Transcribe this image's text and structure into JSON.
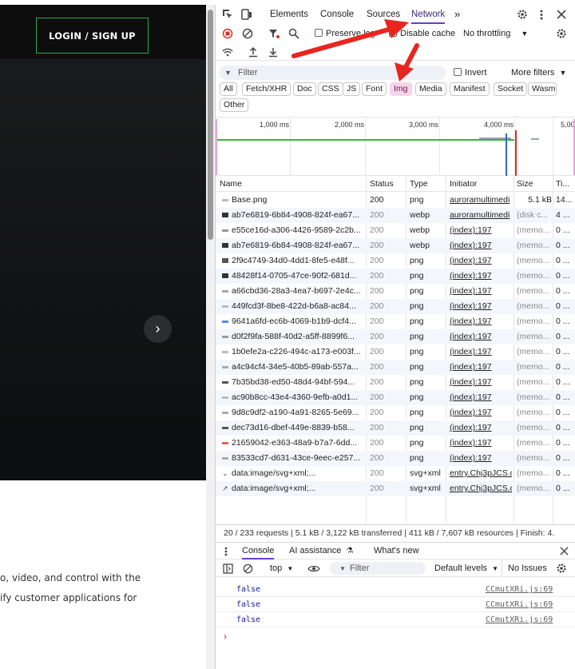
{
  "site": {
    "login_label": "LOGIN / SIGN UP",
    "next_arrow": "›",
    "paragraph_line1": "o, video, and control with the",
    "paragraph_line2": "ify customer applications for"
  },
  "devtools": {
    "tabs": [
      "Elements",
      "Console",
      "Sources",
      "Network"
    ],
    "more_tabs": "»",
    "preserve_log": "Preserve log",
    "disable_cache": "Disable cache",
    "throttling": "No throttling",
    "filter_placeholder": "Filter",
    "invert": "Invert",
    "more_filters": "More filters",
    "type_filters": [
      "All",
      "Fetch/XHR",
      "Doc",
      "CSS",
      "JS",
      "Font",
      "Img",
      "Media",
      "Manifest",
      "Socket",
      "Wasm",
      "Other"
    ],
    "active_type": "Img",
    "timeline_ticks": [
      "1,000 ms",
      "2,000 ms",
      "3,000 ms",
      "4,000 ms",
      "5,00"
    ],
    "columns": [
      "Name",
      "Status",
      "Type",
      "Initiator",
      "Size",
      "Ti..."
    ],
    "rows": [
      {
        "name": "Base.png",
        "status": "200",
        "type": "png",
        "initiator": "auroramultimedi",
        "size": "5.1 kB",
        "time": "14..."
      },
      {
        "name": "ab7e6819-6b84-4908-824f-ea67...",
        "status": "200",
        "type": "webp",
        "initiator": "auroramultimedi",
        "size": "(disk c...",
        "time": "4 ..."
      },
      {
        "name": "e55ce16d-a306-4426-9589-2c2b...",
        "status": "200",
        "type": "webp",
        "initiator": "(index):197",
        "size": "(memo...",
        "time": "0 ..."
      },
      {
        "name": "ab7e6819-6b84-4908-824f-ea67...",
        "status": "200",
        "type": "webp",
        "initiator": "(index):197",
        "size": "(memo...",
        "time": "0 ..."
      },
      {
        "name": "2f9c4749-34d0-4dd1-8fe5-e48f...",
        "status": "200",
        "type": "png",
        "initiator": "(index):197",
        "size": "(memo...",
        "time": "0 ..."
      },
      {
        "name": "48428f14-0705-47ce-90f2-681d...",
        "status": "200",
        "type": "png",
        "initiator": "(index):197",
        "size": "(memo...",
        "time": "0 ..."
      },
      {
        "name": "a66cbd36-28a3-4ea7-b697-2e4c...",
        "status": "200",
        "type": "png",
        "initiator": "(index):197",
        "size": "(memo...",
        "time": "0 ..."
      },
      {
        "name": "449fcd3f-8be8-422d-b6a8-ac84...",
        "status": "200",
        "type": "png",
        "initiator": "(index):197",
        "size": "(memo...",
        "time": "0 ..."
      },
      {
        "name": "9641a6fd-ec6b-4069-b1b9-dcf4...",
        "status": "200",
        "type": "png",
        "initiator": "(index):197",
        "size": "(memo...",
        "time": "0 ..."
      },
      {
        "name": "d0f2f9fa-588f-40d2-a5ff-8899f6...",
        "status": "200",
        "type": "png",
        "initiator": "(index):197",
        "size": "(memo...",
        "time": "0 ..."
      },
      {
        "name": "1b0efe2a-c226-494c-a173-e003f...",
        "status": "200",
        "type": "png",
        "initiator": "(index):197",
        "size": "(memo...",
        "time": "0 ..."
      },
      {
        "name": "a4c94cf4-34e5-40b5-89ab-557a...",
        "status": "200",
        "type": "png",
        "initiator": "(index):197",
        "size": "(memo...",
        "time": "0 ..."
      },
      {
        "name": "7b35bd38-ed50-48d4-94bf-594...",
        "status": "200",
        "type": "png",
        "initiator": "(index):197",
        "size": "(memo...",
        "time": "0 ..."
      },
      {
        "name": "ac90b8cc-43e4-4360-9efb-a0d1...",
        "status": "200",
        "type": "png",
        "initiator": "(index):197",
        "size": "(memo...",
        "time": "0 ..."
      },
      {
        "name": "9d8c9df2-a190-4a91-8265-5e69...",
        "status": "200",
        "type": "png",
        "initiator": "(index):197",
        "size": "(memo...",
        "time": "0 ..."
      },
      {
        "name": "dec73d16-dbef-449e-8839-b58...",
        "status": "200",
        "type": "png",
        "initiator": "(index):197",
        "size": "(memo...",
        "time": "0 ..."
      },
      {
        "name": "21659042-e363-48a9-b7a7-6dd...",
        "status": "200",
        "type": "png",
        "initiator": "(index):197",
        "size": "(memo...",
        "time": "0 ..."
      },
      {
        "name": "83533cd7-d631-43ce-9eec-e257...",
        "status": "200",
        "type": "png",
        "initiator": "(index):197",
        "size": "(memo...",
        "time": "0 ..."
      },
      {
        "name": "data:image/svg+xml;...",
        "status": "200",
        "type": "svg+xml",
        "initiator": "entry.Chj3pJCS.c",
        "size": "(memo...",
        "time": "0 ..."
      },
      {
        "name": "data:image/svg+xml;...",
        "status": "200",
        "type": "svg+xml",
        "initiator": "entry.Chj3pJCS.c",
        "size": "(memo...",
        "time": "0 ..."
      }
    ],
    "summary": "20 / 233 requests  |  5.1 kB / 3,122 kB transferred  |  411 kB / 7,607 kB resources  |  Finish: 4.",
    "drawer_tabs": [
      "Console",
      "AI assistance",
      "What's new"
    ],
    "console_context": "top",
    "console_filter": "Filter",
    "default_levels": "Default levels",
    "no_issues": "No Issues",
    "console_lines": [
      {
        "value": "false",
        "source": "CCmutXRi.js:69"
      },
      {
        "value": "false",
        "source": "CCmutXRi.js:69"
      },
      {
        "value": "false",
        "source": "CCmutXRi.js:69"
      }
    ],
    "prompt": "›"
  },
  "colors": {
    "accent": "#6b3ad6",
    "img_chip": "#f6d4ea",
    "annotation": "#e8261f",
    "login_border": "#2ea84a"
  }
}
